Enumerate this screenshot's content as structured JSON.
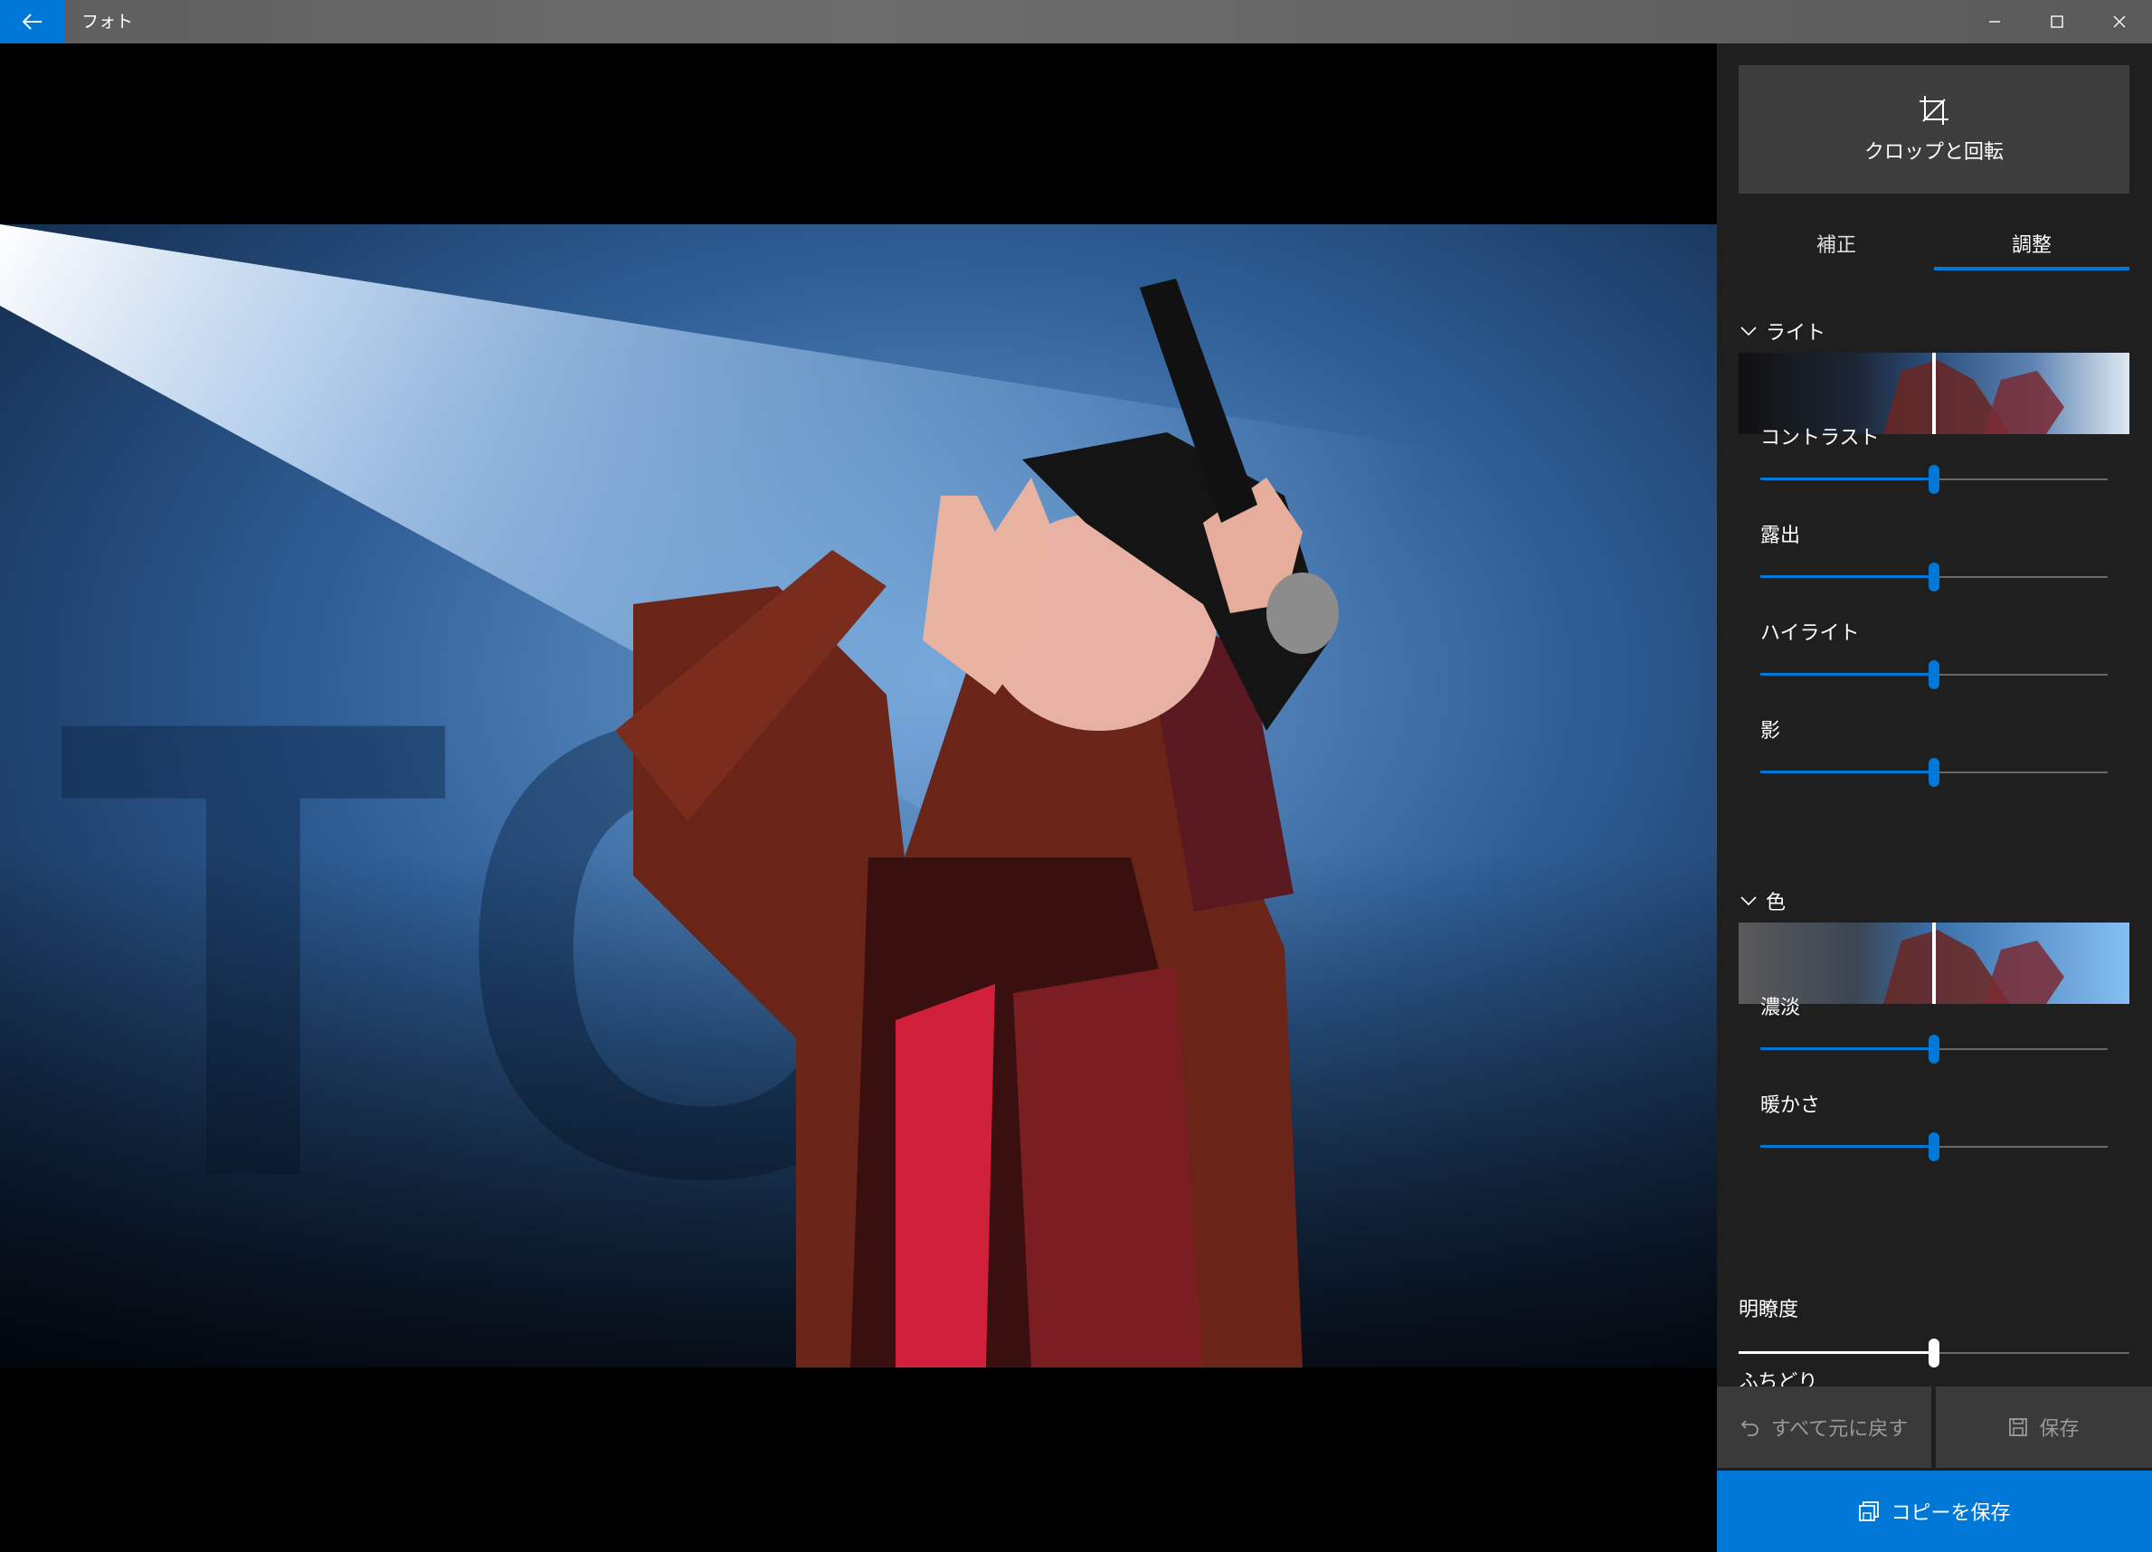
{
  "window": {
    "title": "フォト"
  },
  "editor": {
    "crop_label": "クロップと回転",
    "tabs": [
      {
        "label": "補正"
      },
      {
        "label": "調整"
      }
    ],
    "active_tab": "調整",
    "sections": {
      "light": {
        "title": "ライト",
        "sliders": [
          {
            "label": "コントラスト",
            "value": 0.5
          },
          {
            "label": "露出",
            "value": 0.5
          },
          {
            "label": "ハイライト",
            "value": 0.5
          },
          {
            "label": "影",
            "value": 0.5
          }
        ]
      },
      "color": {
        "title": "色",
        "sliders": [
          {
            "label": "濃淡",
            "value": 0.5
          },
          {
            "label": "暖かさ",
            "value": 0.5
          }
        ]
      },
      "clarity": {
        "label": "明瞭度",
        "value": 0.5
      },
      "vignette": {
        "label": "ふちどり"
      }
    },
    "buttons": {
      "revert_label": "すべて元に戻す",
      "save_label": "保存",
      "save_copy_label": "コピーを保存"
    }
  },
  "colors": {
    "accent": "#0078d7",
    "panel_bg": "#1f1f1f",
    "button_bg": "#3d3d3d"
  },
  "icons": {
    "back": "back-arrow-icon",
    "minimize": "minimize-icon",
    "maximize": "maximize-icon",
    "close": "close-icon",
    "crop": "crop-icon",
    "chevron": "chevron-down-icon",
    "undo": "undo-icon",
    "save": "save-icon",
    "save_copy": "save-copy-icon"
  }
}
